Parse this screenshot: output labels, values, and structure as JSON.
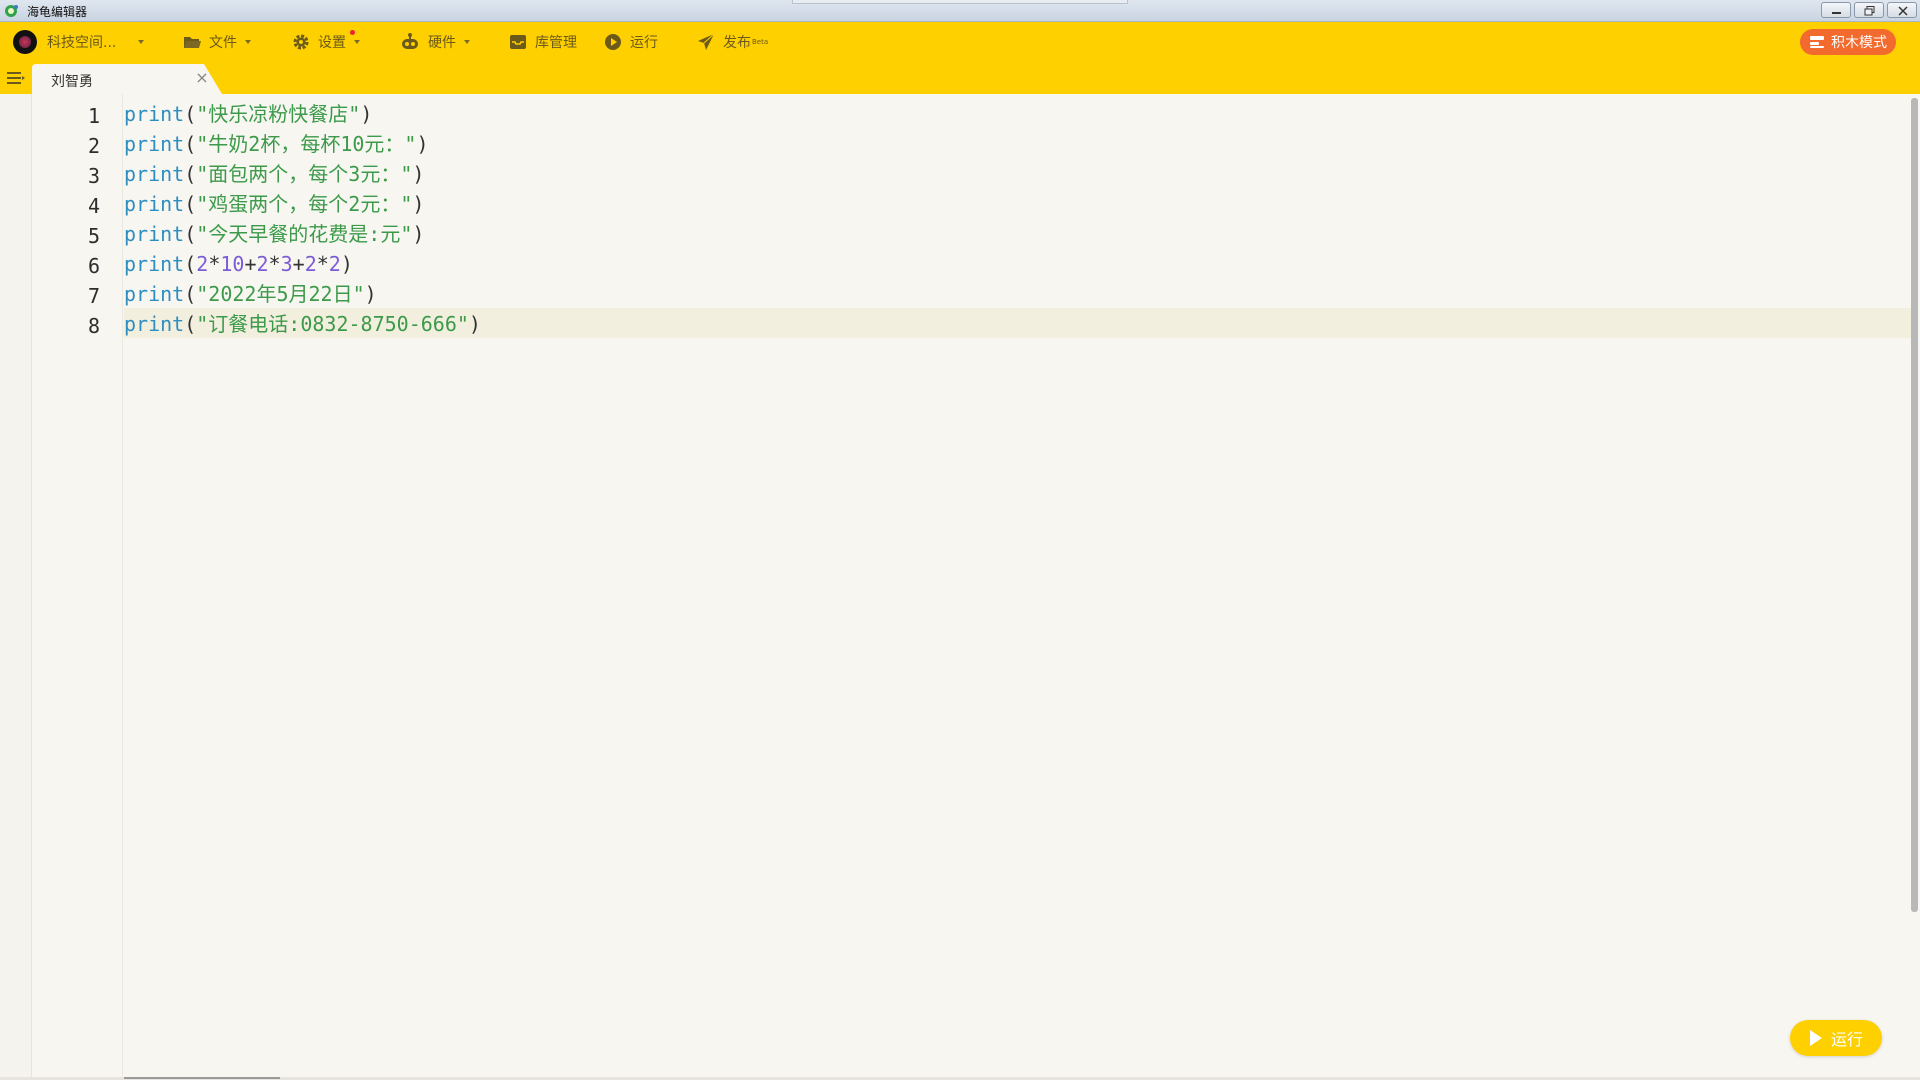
{
  "window": {
    "title": "海龟编辑器"
  },
  "toolbar": {
    "account_label": "科技空间...",
    "file_label": "文件",
    "settings_label": "设置",
    "hardware_label": "硬件",
    "library_label": "库管理",
    "run_label": "运行",
    "publish_label": "发布",
    "publish_badge": "Beta",
    "block_mode_label": "积木模式"
  },
  "tabs": [
    {
      "label": "刘智勇",
      "active": true
    }
  ],
  "editor": {
    "current_line": 8,
    "line_numbers": [
      "1",
      "2",
      "3",
      "4",
      "5",
      "6",
      "7",
      "8"
    ],
    "lines": [
      [
        {
          "t": "kw",
          "v": "print"
        },
        {
          "t": "punc",
          "v": "("
        },
        {
          "t": "str",
          "v": "\"快乐凉粉快餐店\""
        },
        {
          "t": "punc",
          "v": ")"
        }
      ],
      [
        {
          "t": "kw",
          "v": "print"
        },
        {
          "t": "punc",
          "v": "("
        },
        {
          "t": "str",
          "v": "\"牛奶2杯，每杯10元：\""
        },
        {
          "t": "punc",
          "v": ")"
        }
      ],
      [
        {
          "t": "kw",
          "v": "print"
        },
        {
          "t": "punc",
          "v": "("
        },
        {
          "t": "str",
          "v": "\"面包两个，每个3元：\""
        },
        {
          "t": "punc",
          "v": ")"
        }
      ],
      [
        {
          "t": "kw",
          "v": "print"
        },
        {
          "t": "punc",
          "v": "("
        },
        {
          "t": "str",
          "v": "\"鸡蛋两个，每个2元：\""
        },
        {
          "t": "punc",
          "v": ")"
        }
      ],
      [
        {
          "t": "kw",
          "v": "print"
        },
        {
          "t": "punc",
          "v": "("
        },
        {
          "t": "str",
          "v": "\"今天早餐的花费是:元\""
        },
        {
          "t": "punc",
          "v": ")"
        }
      ],
      [
        {
          "t": "kw",
          "v": "print"
        },
        {
          "t": "punc",
          "v": "("
        },
        {
          "t": "num",
          "v": "2"
        },
        {
          "t": "punc",
          "v": "*"
        },
        {
          "t": "num",
          "v": "10"
        },
        {
          "t": "punc",
          "v": "+"
        },
        {
          "t": "num",
          "v": "2"
        },
        {
          "t": "punc",
          "v": "*"
        },
        {
          "t": "num",
          "v": "3"
        },
        {
          "t": "punc",
          "v": "+"
        },
        {
          "t": "num",
          "v": "2"
        },
        {
          "t": "punc",
          "v": "*"
        },
        {
          "t": "num",
          "v": "2"
        },
        {
          "t": "punc",
          "v": ")"
        }
      ],
      [
        {
          "t": "kw",
          "v": "print"
        },
        {
          "t": "punc",
          "v": "("
        },
        {
          "t": "str",
          "v": "\"2022年5月22日\""
        },
        {
          "t": "punc",
          "v": ")"
        }
      ],
      [
        {
          "t": "kw",
          "v": "print"
        },
        {
          "t": "punc",
          "v": "("
        },
        {
          "t": "str",
          "v": "\"订餐电话:0832-8750-666\""
        },
        {
          "t": "punc",
          "v": ")"
        }
      ]
    ]
  },
  "run_button": {
    "label": "运行"
  },
  "colors": {
    "accent": "#ffd000",
    "block_mode": "#f26a2e",
    "keyword": "#2f8ec0",
    "string": "#3d9a4a",
    "number": "#7b5bd6"
  },
  "icons": {
    "app": "turtle-logo-icon",
    "file": "folder-icon",
    "settings": "gear-icon",
    "hardware": "robot-icon",
    "library": "inbox-icon",
    "run": "play-circle-icon",
    "publish": "paper-plane-icon",
    "block_mode": "blocks-icon",
    "sidebar": "menu-icon",
    "close": "close-icon"
  }
}
